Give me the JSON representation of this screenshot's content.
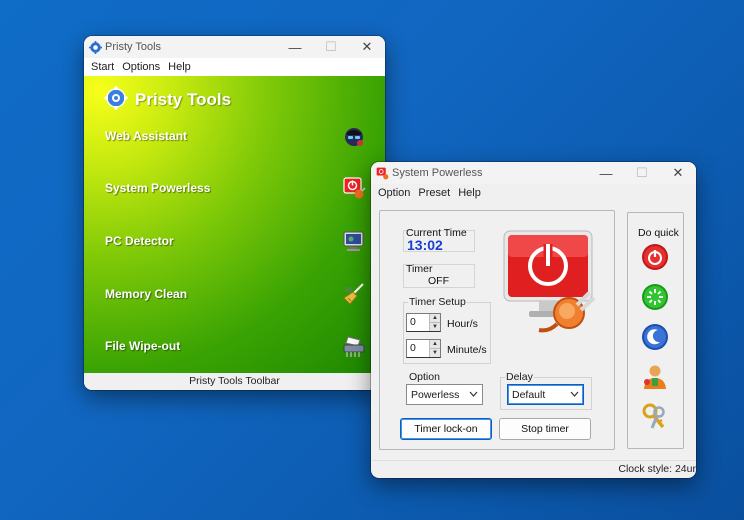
{
  "pristy": {
    "title": "Pristy Tools",
    "menu": [
      "Start",
      "Options",
      "Help"
    ],
    "brand": "Pristy Tools",
    "items": [
      {
        "label": "Web Assistant",
        "icon": "spy-icon"
      },
      {
        "label": "System Powerless",
        "icon": "power-plug-icon"
      },
      {
        "label": "PC Detector",
        "icon": "monitor-icon"
      },
      {
        "label": "Memory Clean",
        "icon": "broom-icon"
      },
      {
        "label": "File Wipe-out",
        "icon": "shredder-icon"
      }
    ],
    "status": "Pristy Tools Toolbar"
  },
  "power": {
    "title": "System Powerless",
    "menu": [
      "Option",
      "Preset",
      "Help"
    ],
    "current_time_label": "Current Time",
    "current_time": "13:02",
    "timer_label": "Timer",
    "timer_value": "OFF",
    "timer_setup_label": "Timer Setup",
    "hours_value": "0",
    "hours_unit": "Hour/s",
    "minutes_value": "0",
    "minutes_unit": "Minute/s",
    "option_label": "Option",
    "option_selected": "Powerless",
    "delay_label": "Delay",
    "delay_selected": "Default",
    "lock_button": "Timer lock-on",
    "stop_button": "Stop timer",
    "do_quick_label": "Do quick",
    "quick_actions": [
      "shutdown-icon",
      "restart-icon",
      "sleep-icon",
      "log-off-icon",
      "lock-icon"
    ],
    "status": "Clock style: 24ur"
  },
  "colors": {
    "desktop": "#0f6cc7",
    "time_blue": "#1a3fd1",
    "power_red": "#e02020",
    "primary_button_border": "#0a5fc4"
  }
}
